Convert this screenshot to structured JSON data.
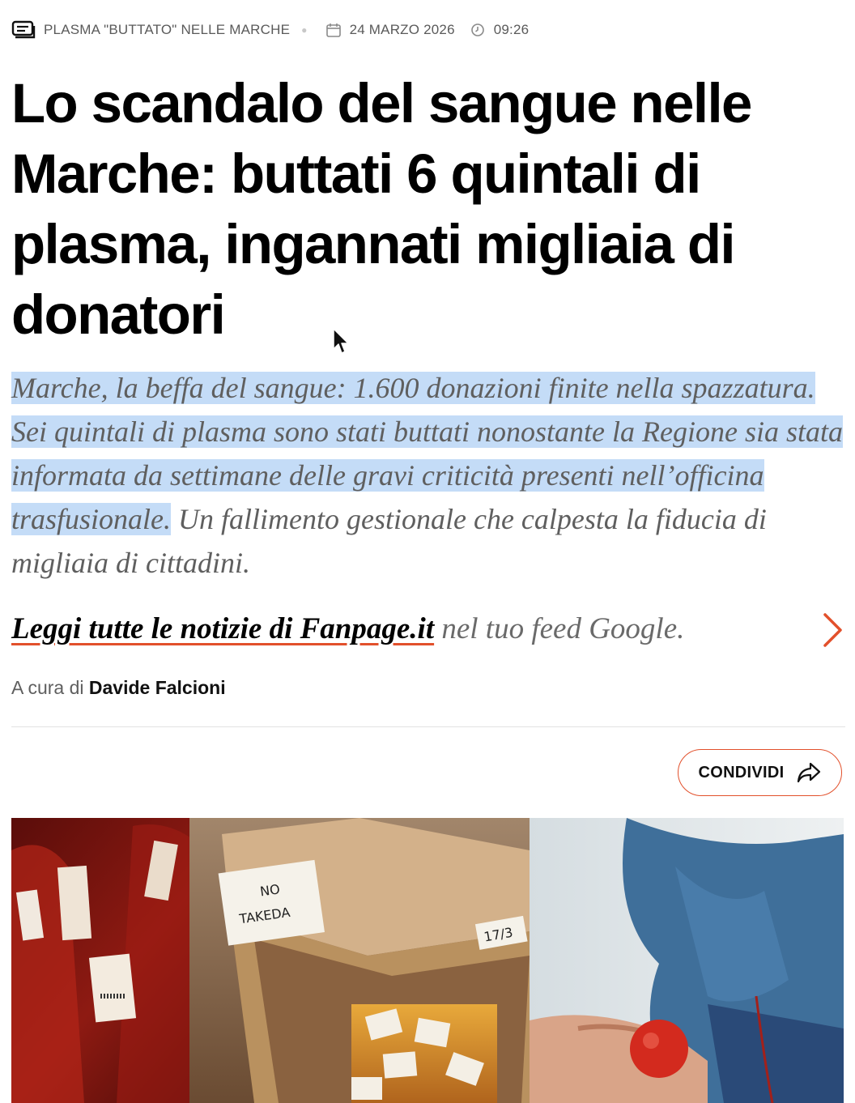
{
  "meta": {
    "section_label": "PLASMA \"BUTTATO\" NELLE MARCHE",
    "date": "24 MARZO 2026",
    "time": "09:26",
    "icons": [
      "section-icon",
      "calendar-icon",
      "clock-icon"
    ]
  },
  "article": {
    "headline": "Lo scandalo del sangue nelle Marche: buttati 6 quintali di plasma, ingannati migliaia di donatori",
    "summary_highlighted": "Marche, la beffa del sangue: 1.600 donazioni finite nella spazzatura. Sei quintali di plasma sono stati buttati nonostante la Regione sia stata informata da settimane delle gravi criticità presenti nell’officina trasfusionale.",
    "summary_rest": " Un fallimento gestionale che calpesta la fiducia di migliaia di cittadini."
  },
  "google_feed": {
    "link_text": "Leggi tutte le notizie di Fanpage.it",
    "suffix_text": " nel tuo feed Google."
  },
  "byline": {
    "prefix": "A cura di ",
    "author": "Davide Falcioni"
  },
  "share": {
    "label": "CONDIVIDI"
  },
  "hero_image": {
    "box_label_1": "NO",
    "box_label_2": "TAKEDA",
    "box_label_3": "17/3"
  },
  "colors": {
    "accent": "#e2502b",
    "highlight": "#c4dcf7",
    "summary_text": "#5f5f5f"
  }
}
